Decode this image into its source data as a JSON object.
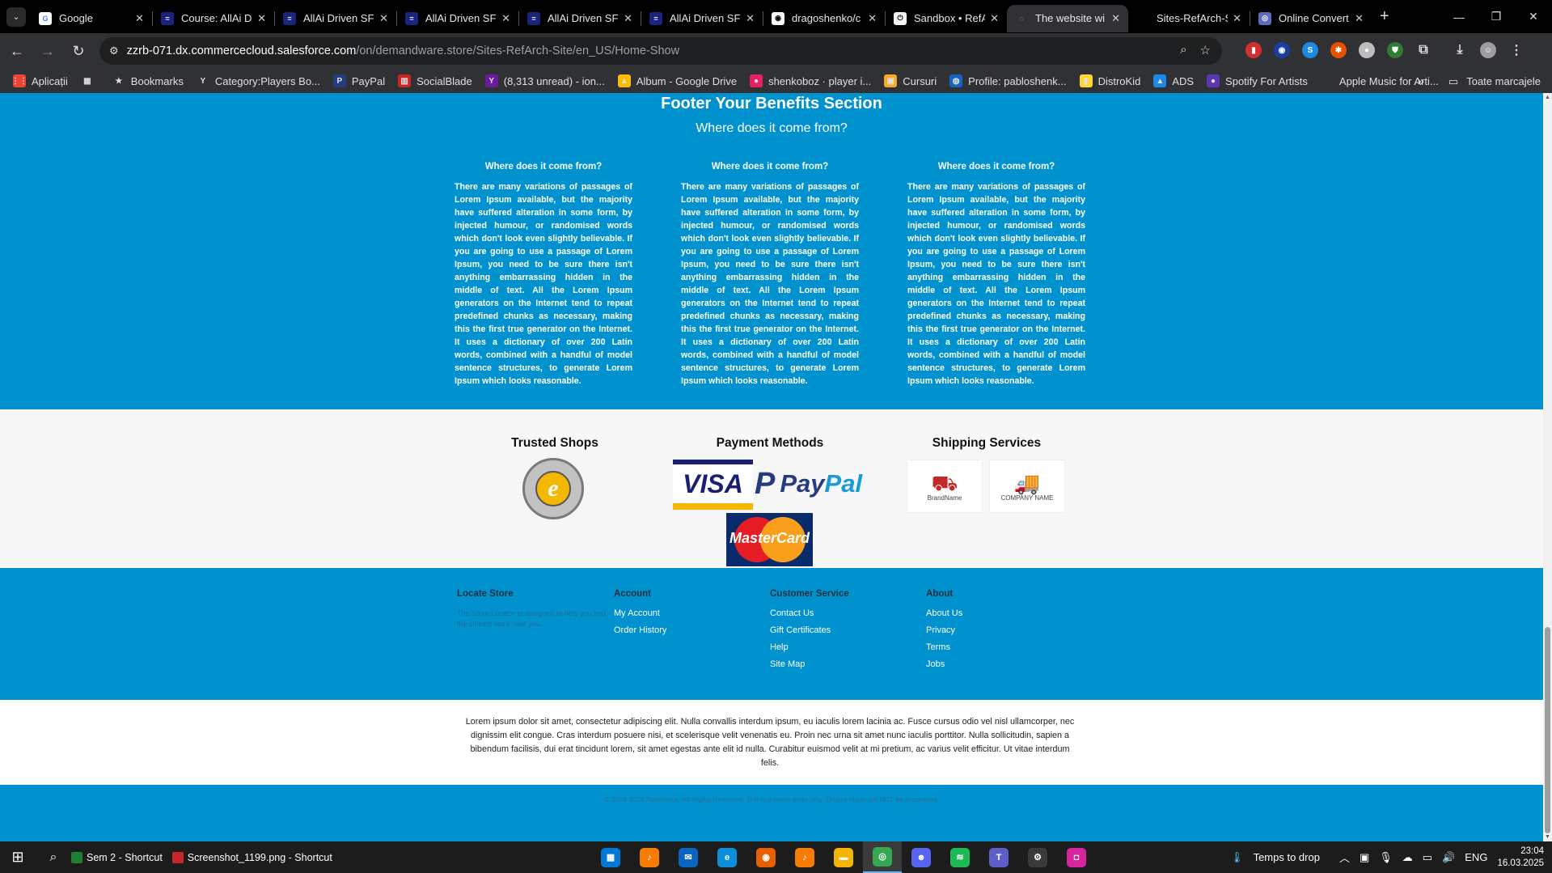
{
  "browser": {
    "tabs": [
      {
        "title": "Google",
        "fav_color": "#ffffff",
        "fav_text": "G",
        "fav_fg": "#4285f4"
      },
      {
        "title": "Course: AllAi Driven SF",
        "fav_color": "#1a237e",
        "fav_text": "=",
        "fav_fg": "#ffffff"
      },
      {
        "title": "AllAi Driven SF",
        "fav_color": "#1a237e",
        "fav_text": "=",
        "fav_fg": "#ffffff"
      },
      {
        "title": "AllAi Driven SF",
        "fav_color": "#1a237e",
        "fav_text": "=",
        "fav_fg": "#ffffff"
      },
      {
        "title": "AllAi Driven SF",
        "fav_color": "#1a237e",
        "fav_text": "=",
        "fav_fg": "#ffffff"
      },
      {
        "title": "AllAi Driven SF",
        "fav_color": "#1a237e",
        "fav_text": "=",
        "fav_fg": "#ffffff"
      },
      {
        "title": "dragoshenko/c",
        "fav_color": "#ffffff",
        "fav_text": "◉",
        "fav_fg": "#000000"
      },
      {
        "title": "Sandbox • RefA",
        "fav_color": "#f5f5f5",
        "fav_text": "⏻",
        "fav_fg": "#000000"
      },
      {
        "title": "The website wi",
        "fav_color": "#303134",
        "fav_text": "◌",
        "fav_fg": "#cccccc"
      },
      {
        "title": "Sites-RefArch-S",
        "fav_color": "#000000",
        "fav_text": "",
        "fav_fg": "#ffffff"
      },
      {
        "title": "Online Convert",
        "fav_color": "#5c6bc0",
        "fav_text": "◎",
        "fav_fg": "#ffffff"
      }
    ],
    "active_tab_index": 8,
    "url_host": "zzrb-071.dx.commercecloud.salesforce.com",
    "url_path": "/on/demandware.store/Sites-RefArch-Site/en_US/Home-Show",
    "bookmarks": [
      {
        "label": "Aplicații",
        "color": "#ea4335",
        "glyph": "⋮⋮"
      },
      {
        "label": "",
        "color": "#303134",
        "glyph": "▦"
      },
      {
        "label": "Bookmarks",
        "color": "#303134",
        "glyph": "★"
      },
      {
        "label": "Category:Players Bo...",
        "color": "#303134",
        "glyph": "Y"
      },
      {
        "label": "PayPal",
        "color": "#253b80",
        "glyph": "P"
      },
      {
        "label": "SocialBlade",
        "color": "#c62828",
        "glyph": "▥"
      },
      {
        "label": "(8,313 unread) - ion...",
        "color": "#6a1b9a",
        "glyph": "Y"
      },
      {
        "label": "Album - Google Drive",
        "color": "#fbbc04",
        "glyph": "▲"
      },
      {
        "label": "shenkoboz · player i...",
        "color": "#e91e63",
        "glyph": "●"
      },
      {
        "label": "Cursuri",
        "color": "#f9a825",
        "glyph": "▣"
      },
      {
        "label": "Profile: pabloshenk...",
        "color": "#1565c0",
        "glyph": "◍"
      },
      {
        "label": "DistroKid",
        "color": "#fdd835",
        "glyph": "▮"
      },
      {
        "label": "ADS",
        "color": "#1e88e5",
        "glyph": "▲"
      },
      {
        "label": "Spotify For Artists",
        "color": "#5e35b1",
        "glyph": "●"
      },
      {
        "label": "Apple Music for Arti...",
        "color": "#303134",
        "glyph": ""
      }
    ],
    "bookmarks_more": "»",
    "all_bookmarks_label": "Toate marcajele"
  },
  "benefits": {
    "title": "Footer Your Benefits Section",
    "subtitle": "Where does it come from?",
    "columns": [
      {
        "heading": "Where does it come from?",
        "text": "There are many variations of passages of Lorem Ipsum available, but the majority have suffered alteration in some form, by injected humour, or randomised words which don't look even slightly believable. If you are going to use a passage of Lorem Ipsum, you need to be sure there isn't anything embarrassing hidden in the middle of text. All the Lorem Ipsum generators on the Internet tend to repeat predefined chunks as necessary, making this the first true generator on the Internet. It uses a dictionary of over 200 Latin words, combined with a handful of model sentence structures, to generate Lorem Ipsum which looks reasonable."
      },
      {
        "heading": "Where does it come from?",
        "text": "There are many variations of passages of Lorem Ipsum available, but the majority have suffered alteration in some form, by injected humour, or randomised words which don't look even slightly believable. If you are going to use a passage of Lorem Ipsum, you need to be sure there isn't anything embarrassing hidden in the middle of text. All the Lorem Ipsum generators on the Internet tend to repeat predefined chunks as necessary, making this the first true generator on the Internet. It uses a dictionary of over 200 Latin words, combined with a handful of model sentence structures, to generate Lorem Ipsum which looks reasonable."
      },
      {
        "heading": "Where does it come from?",
        "text": "There are many variations of passages of Lorem Ipsum available, but the majority have suffered alteration in some form, by injected humour, or randomised words which don't look even slightly believable. If you are going to use a passage of Lorem Ipsum, you need to be sure there isn't anything embarrassing hidden in the middle of text. All the Lorem Ipsum generators on the Internet tend to repeat predefined chunks as necessary, making this the first true generator on the Internet. It uses a dictionary of over 200 Latin words, combined with a handful of model sentence structures, to generate Lorem Ipsum which looks reasonable."
      }
    ]
  },
  "partners": {
    "trusted_title": "Trusted Shops",
    "trusted_badge_glyph": "e",
    "payment_title": "Payment Methods",
    "visa": "VISA",
    "paypal_pay": "Pay",
    "paypal_pal": "Pal",
    "mastercard": "MasterCard",
    "shipping_title": "Shipping Services",
    "shipping_logos": [
      {
        "label": "BrandName",
        "icon": "⛟"
      },
      {
        "label": "COMPANY NAME",
        "icon": "🚚"
      }
    ]
  },
  "footer": {
    "locate": {
      "heading": "Locate Store",
      "desc": "The Store Locator is designed to help you find the closest store near you."
    },
    "account": {
      "heading": "Account",
      "links": [
        "My Account",
        "Order History"
      ]
    },
    "service": {
      "heading": "Customer Service",
      "links": [
        "Contact Us",
        "Gift Certificates",
        "Help",
        "Site Map"
      ]
    },
    "about": {
      "heading": "About",
      "links": [
        "About Us",
        "Privacy",
        "Terms",
        "Jobs"
      ]
    },
    "legal_text": "Lorem ipsum dolor sit amet, consectetur adipiscing elit. Nulla convallis interdum ipsum, eu iaculis lorem lacinia ac. Fusce cursus odio vel nisl ullamcorper, nec dignissim elit congue. Cras interdum posuere nisi, et scelerisque velit venenatis eu. Proin nec urna sit amet nunc iaculis porttitor. Nulla sollicitudin, sapien a bibendum facilisis, dui erat tincidunt lorem, sit amet egestas ante elit id nulla. Curabitur euismod velit at mi pretium, ac varius velit efficitur. Ut vitae interdum felis.",
    "copyright": "© 2004-2024 Salesforce. All Rights Reserved. This is a demo store only. Orders made will NOT be processed."
  },
  "taskbar": {
    "shortcuts": [
      {
        "label": "Sem 2 - Shortcut",
        "color": "#1e7e34"
      },
      {
        "label": "Screenshot_1199.png - Shortcut",
        "color": "#c62828"
      }
    ],
    "apps": [
      {
        "name": "store",
        "color": "#0078d4",
        "glyph": "▦"
      },
      {
        "name": "fl-studio",
        "color": "#f57c00",
        "glyph": "♪"
      },
      {
        "name": "mail",
        "color": "#0a64c2",
        "glyph": "✉"
      },
      {
        "name": "edge",
        "color": "#0c8ed9",
        "glyph": "e"
      },
      {
        "name": "firefox",
        "color": "#e66000",
        "glyph": "◉"
      },
      {
        "name": "fl-studio-2",
        "color": "#f57c00",
        "glyph": "♪"
      },
      {
        "name": "explorer",
        "color": "#f4b400",
        "glyph": "▬"
      },
      {
        "name": "chrome",
        "color": "#34a853",
        "glyph": "◎"
      },
      {
        "name": "discord",
        "color": "#5865f2",
        "glyph": "☻"
      },
      {
        "name": "spotify",
        "color": "#1db954",
        "glyph": "≋"
      },
      {
        "name": "teams",
        "color": "#5b5fc7",
        "glyph": "T"
      },
      {
        "name": "settings",
        "color": "#3a3a3a",
        "glyph": "⚙"
      },
      {
        "name": "instagram",
        "color": "#d6249f",
        "glyph": "◘"
      }
    ],
    "active_app_index": 7,
    "weather": "Temps to drop",
    "language": "ENG",
    "time": "23:04",
    "date": "16.03.2025"
  }
}
